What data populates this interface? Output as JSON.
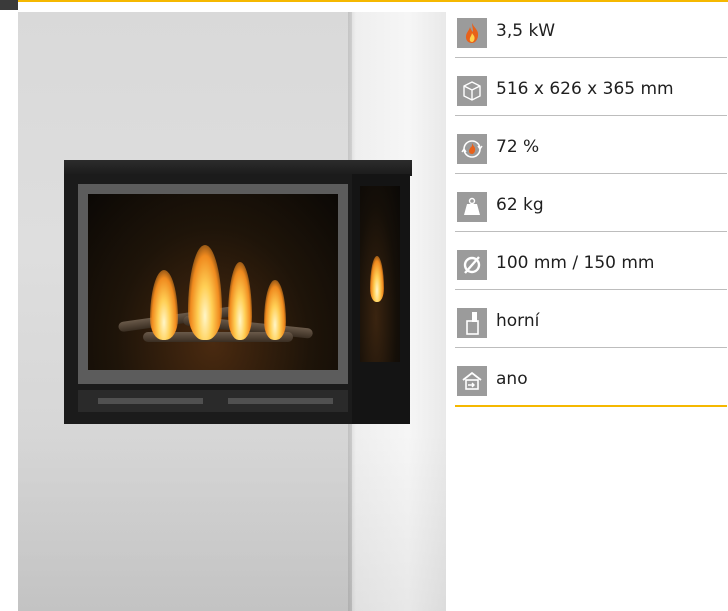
{
  "specs": [
    {
      "icon": "flame-icon",
      "value": "3,5 kW"
    },
    {
      "icon": "box-dimensions-icon",
      "value": "516 x 626 x 365 mm"
    },
    {
      "icon": "efficiency-icon",
      "value": "72 %"
    },
    {
      "icon": "weight-icon",
      "value": "62 kg"
    },
    {
      "icon": "diameter-icon",
      "value": "100 mm / 150 mm"
    },
    {
      "icon": "flue-outlet-icon",
      "value": "horní"
    },
    {
      "icon": "air-intake-icon",
      "value": "ano"
    }
  ],
  "colors": {
    "accent": "#f5b800",
    "icon_bg": "#9b9b9b",
    "divider": "#bdbdbd",
    "text": "#1f1f1f"
  }
}
